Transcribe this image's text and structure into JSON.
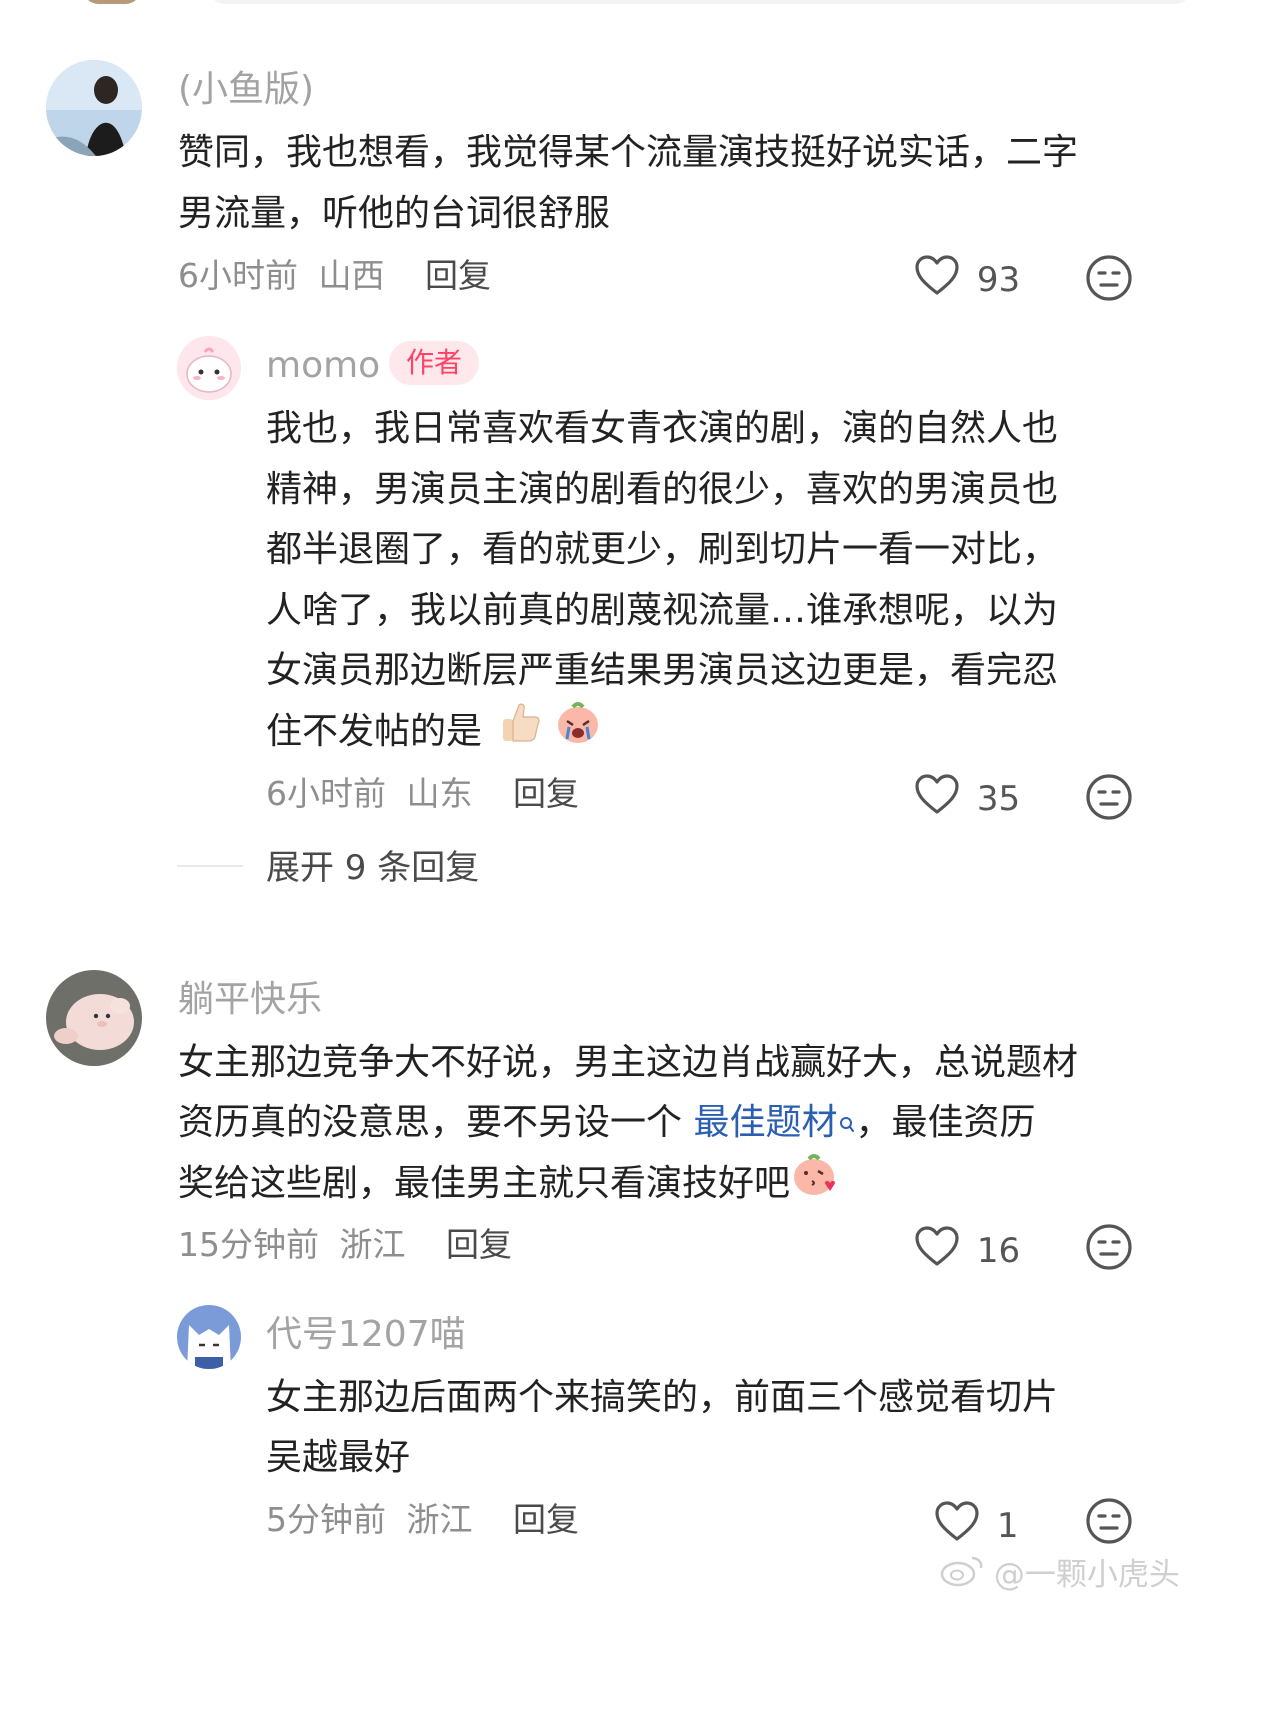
{
  "comments": [
    {
      "username": "(小鱼版)",
      "text_line1": "赞同，我也想看，我觉得某个流量演技挺好说实话，二字",
      "text_line2": "男流量，听他的台词很舒服",
      "time": "6小时前",
      "location": "山西",
      "reply_label": "回复",
      "likes": "93",
      "replies": [
        {
          "username": "momo",
          "badge": "作者",
          "text_lines": [
            "我也，我日常喜欢看女青衣演的剧，演的自然人也",
            "精神，男演员主演的剧看的很少，喜欢的男演员也",
            "都半退圈了，看的就更少，刷到切片一看一对比，",
            "人啥了，我以前真的剧蔑视流量…谁承想呢，以为",
            "女演员那边断层严重结果男演员这边更是，看完忍",
            "住不发帖的是"
          ],
          "time": "6小时前",
          "location": "山东",
          "reply_label": "回复",
          "likes": "35"
        }
      ],
      "expand_label": "展开 9 条回复"
    },
    {
      "username": "躺平快乐",
      "text_line1": "女主那边竞争大不好说，男主这边肖战赢好大，总说题材",
      "text_line2_a": "资历真的没意思，要不另设一个 ",
      "text_line2_link": "最佳题材",
      "text_line2_b": "，最佳资历",
      "text_line3": "奖给这些剧，最佳男主就只看演技好吧",
      "time": "15分钟前",
      "location": "浙江",
      "reply_label": "回复",
      "likes": "16",
      "replies": [
        {
          "username": "代号1207喵",
          "text_line1": "女主那边后面两个来搞笑的，前面三个感觉看切片",
          "text_line2": "吴越最好",
          "time": "5分钟前",
          "location": "浙江",
          "reply_label": "回复",
          "likes": "1"
        }
      ]
    }
  ],
  "watermark": "@一颗小虎头",
  "icons": {
    "like": "heart-outline-icon",
    "dislike": "meh-face-icon",
    "search": "search-icon",
    "weibo": "weibo-logo-icon"
  },
  "colors": {
    "link": "#2b5fb2",
    "author_badge_bg": "#ffe8ec",
    "author_badge_text": "#ff4266"
  }
}
